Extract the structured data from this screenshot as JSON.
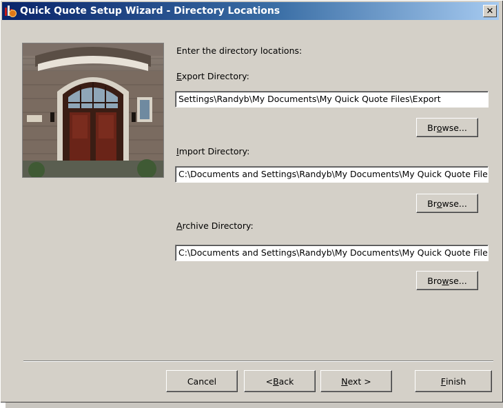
{
  "window": {
    "title": "Quick Quote Setup Wizard - Directory Locations"
  },
  "content": {
    "instruction": "Enter the directory locations:",
    "export": {
      "label_accel": "E",
      "label_rest": "xport Directory:",
      "value": "Settings\\Randyb\\My Documents\\My Quick Quote Files\\Export",
      "browse_pre": "Br",
      "browse_accel": "o",
      "browse_post": "wse..."
    },
    "import": {
      "label_accel": "I",
      "label_rest": "mport Directory:",
      "value": "C:\\Documents and Settings\\Randyb\\My Documents\\My Quick Quote Files\\Import",
      "browse_pre": "Br",
      "browse_accel": "o",
      "browse_post": "wse..."
    },
    "archive": {
      "label_accel": "A",
      "label_rest": "rchive Directory:",
      "value": "C:\\Documents and Settings\\Randyb\\My Documents\\My Quick Quote Files\\Archive",
      "browse_pre": "Bro",
      "browse_accel": "w",
      "browse_post": "se..."
    }
  },
  "footer": {
    "cancel": "Cancel",
    "back_pre": "< ",
    "back_accel": "B",
    "back_post": "ack",
    "next_accel": "N",
    "next_post": "ext >",
    "finish_accel": "F",
    "finish_post": "inish"
  }
}
